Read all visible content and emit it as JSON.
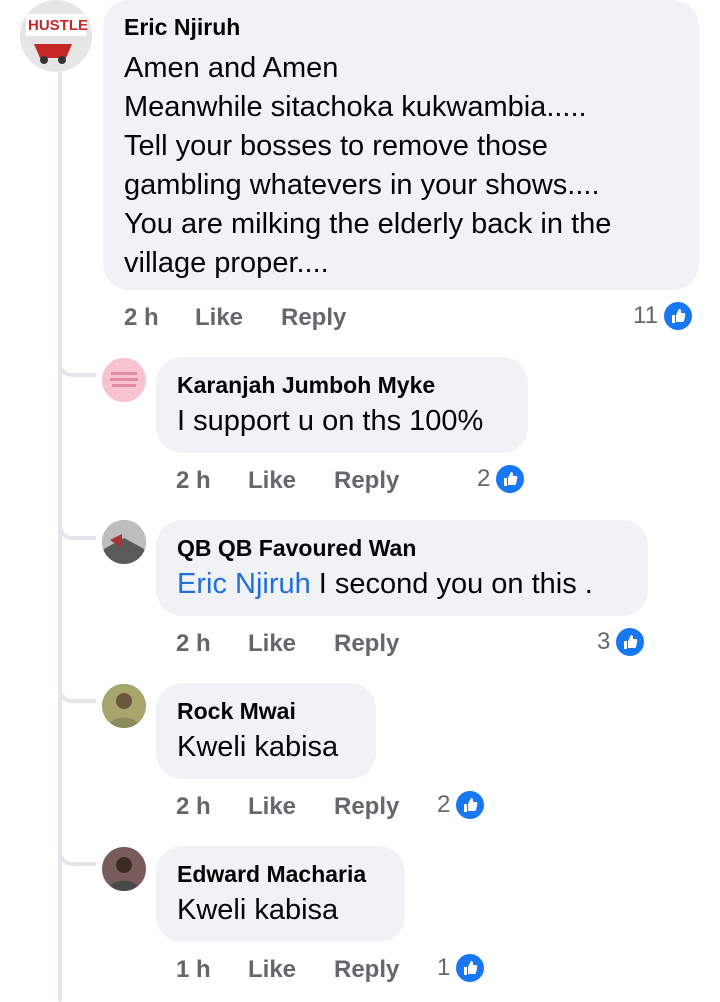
{
  "comments": [
    {
      "author": "Eric Njiruh",
      "text": "Amen and Amen\nMeanwhile sitachoka kukwambia.....\nTell your bosses to remove those\ngambling whatevers in your shows....\nYou are milking the elderly back in the\nvillage proper....",
      "time": "2 h",
      "like": "Like",
      "reply": "Reply",
      "reactions": "11",
      "avatar_text": "HUSTLE"
    },
    {
      "author": "Karanjah Jumboh Myke",
      "text": "I support u on ths 100%",
      "time": "2 h",
      "like": "Like",
      "reply": "Reply",
      "reactions": "2"
    },
    {
      "author": "QB QB Favoured Wan",
      "mention": "Eric Njiruh",
      "text": " I second you on this .",
      "time": "2 h",
      "like": "Like",
      "reply": "Reply",
      "reactions": "3"
    },
    {
      "author": "Rock Mwai",
      "text": "Kweli kabisa",
      "time": "2 h",
      "like": "Like",
      "reply": "Reply",
      "reactions": "2"
    },
    {
      "author": "Edward Macharia",
      "text": "Kweli kabisa",
      "time": "1 h",
      "like": "Like",
      "reply": "Reply",
      "reactions": "1"
    }
  ],
  "colors": {
    "bubble": "#f0f2f5",
    "mention": "#216fdb",
    "like_badge": "#1877f2",
    "meta": "#65676b"
  },
  "icons": {
    "reaction": "thumbs-up-icon"
  }
}
